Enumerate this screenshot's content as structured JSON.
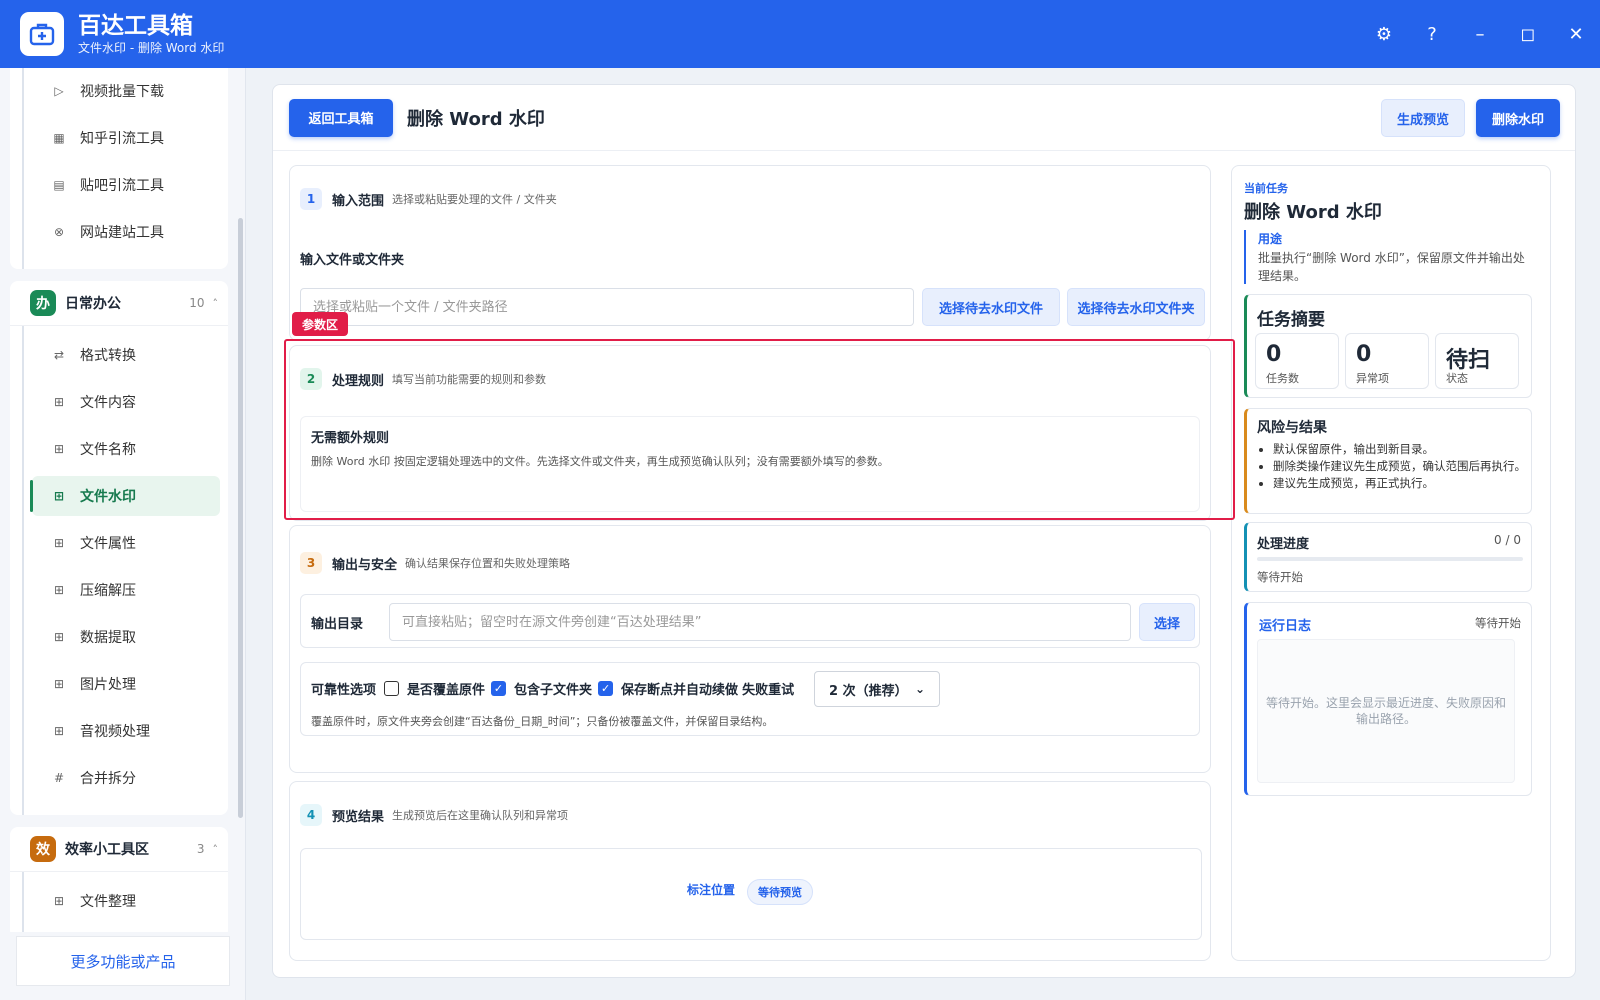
{
  "app": {
    "title": "百达工具箱",
    "subtitle": "文件水印 - 删除 Word 水印"
  },
  "window_controls": [
    "⚙",
    "?",
    "–",
    "◻",
    "✕"
  ],
  "sidebar": {
    "groups": [
      {
        "items": [
          {
            "icon": "▷",
            "label": "视频批量下载"
          },
          {
            "icon": "▦",
            "label": "知乎引流工具"
          },
          {
            "icon": "▤",
            "label": "贴吧引流工具"
          },
          {
            "icon": "⊗",
            "label": "网站建站工具"
          }
        ]
      },
      {
        "badge": "办",
        "name": "日常办公",
        "count": "10",
        "caret": "˄",
        "color": "#1a8a57",
        "items": [
          {
            "icon": "⇄",
            "label": "格式转换"
          },
          {
            "icon": "⊞",
            "label": "文件内容"
          },
          {
            "icon": "⊞",
            "label": "文件名称"
          },
          {
            "icon": "⊞",
            "label": "文件水印",
            "active": true
          },
          {
            "icon": "⊞",
            "label": "文件属性"
          },
          {
            "icon": "⊞",
            "label": "压缩解压"
          },
          {
            "icon": "⊞",
            "label": "数据提取"
          },
          {
            "icon": "⊞",
            "label": "图片处理"
          },
          {
            "icon": "⊞",
            "label": "音视频处理"
          },
          {
            "icon": "#",
            "label": "合并拆分"
          }
        ]
      },
      {
        "badge": "效",
        "name": "效率小工具区",
        "count": "3",
        "caret": "˄",
        "color": "#c66b0e",
        "items": [
          {
            "icon": "⊞",
            "label": "文件整理"
          }
        ]
      }
    ],
    "more_link": "更多功能或产品"
  },
  "header": {
    "back_button": "返回工具箱",
    "title": "删除 Word 水印",
    "preview_button": "生成预览",
    "run_button": "删除水印"
  },
  "step1": {
    "num": "1",
    "title": "输入范围",
    "desc": "选择或粘贴要处理的文件 / 文件夹",
    "field_label": "输入文件或文件夹",
    "placeholder": "选择或粘贴一个文件 / 文件夹路径",
    "select_file_button": "选择待去水印文件",
    "select_folder_button": "选择待去水印文件夹"
  },
  "highlight_tag": "参数区",
  "step2": {
    "num": "2",
    "title": "处理规则",
    "desc": "填写当前功能需要的规则和参数",
    "rule_title": "无需额外规则",
    "rule_desc": "删除 Word 水印 按固定逻辑处理选中的文件。先选择文件或文件夹，再生成预览确认队列；没有需要额外填写的参数。"
  },
  "step3": {
    "num": "3",
    "title": "输出与安全",
    "desc": "确认结果保存位置和失败处理策略",
    "output_label": "输出目录",
    "output_placeholder": "可直接粘贴；留空时在源文件旁创建“百达处理结果”",
    "choose_button": "选择",
    "reliability_label": "可靠性选项",
    "overwrite_label": "是否覆盖原件",
    "overwrite_checked": false,
    "subfolder_label": "包含子文件夹",
    "subfolder_checked": true,
    "resume_label": "保存断点并自动续做",
    "resume_checked": true,
    "retry_label": "失败重试",
    "retry_value": "2 次（推荐）",
    "note": "覆盖原件时，原文件夹旁会创建“百达备份_日期_时间”；只备份被覆盖文件，并保留目录结构。"
  },
  "step4": {
    "num": "4",
    "title": "预览结果",
    "desc": "生成预览后在这里确认队列和异常项",
    "marker_label": "标注位置",
    "status_pill": "等待预览"
  },
  "panel": {
    "caption": "当前任务",
    "title": "删除 Word 水印",
    "usage_heading": "用途",
    "usage_text": "批量执行“删除 Word 水印”，保留原文件并输出处理结果。",
    "summary_title": "任务摘要",
    "summary": [
      {
        "value": "0",
        "label": "任务数"
      },
      {
        "value": "0",
        "label": "异常项"
      },
      {
        "value": "待扫",
        "label": "状态"
      }
    ],
    "risk_title": "风险与结果",
    "risks": [
      "默认保留原件，输出到新目录。",
      "删除类操作建议先生成预览，确认范围后再执行。",
      "建议先生成预览，再正式执行。"
    ],
    "progress_title": "处理进度",
    "progress_count": "0 / 0",
    "progress_fraction": 0,
    "progress_status": "等待开始",
    "log_title": "运行日志",
    "log_status": "等待开始",
    "log_placeholder": "等待开始。这里会显示最近进度、失败原因和输出路径。"
  },
  "colors": {
    "primary": "#2563eb",
    "office_green": "#1a8a57",
    "efficiency_orange": "#c66b0e",
    "highlight_red": "#e11d48"
  }
}
